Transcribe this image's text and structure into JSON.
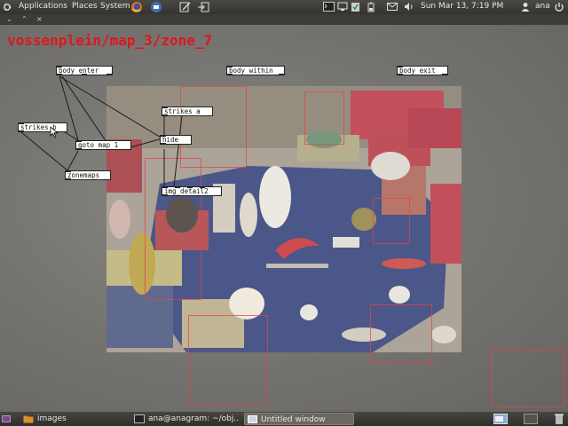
{
  "top_panel": {
    "menus": [
      "Applications",
      "Places",
      "System"
    ],
    "clock": "Sun Mar 13,  7:19 PM",
    "user": "ana",
    "icons": [
      "ubuntu-logo-icon",
      "firefox-icon",
      "thunderbird-icon",
      "text-editor-icon",
      "exit-icon",
      "terminal-icon",
      "network-icon",
      "clipboard-icon",
      "battery-icon",
      "mail-icon",
      "volume-icon",
      "power-icon"
    ]
  },
  "window_controls": [
    "⌄",
    "⌃",
    "×"
  ],
  "patch": {
    "title": "vossenplein/map_3/zone_7",
    "objects": {
      "body_enter": "body enter",
      "body_within": "body within",
      "body_exit": "body exit",
      "strikes_a": "strikes a",
      "strikes_b": "strikes b",
      "goto_map": "goto map 1",
      "hide": "hide",
      "zonemaps": "zonemaps",
      "img_detail": "img_detail2"
    }
  },
  "bottom_panel": {
    "tasks": [
      {
        "label": "images",
        "icon": "folder-icon"
      },
      {
        "label": "ana@anagram: ~/obj...",
        "icon": "terminal-icon"
      },
      {
        "label": "Untitled window",
        "icon": "window-icon"
      }
    ]
  },
  "colors": {
    "title_red": "#e0161b",
    "hotspot": "#e24646",
    "panel": "#3c3b37"
  }
}
